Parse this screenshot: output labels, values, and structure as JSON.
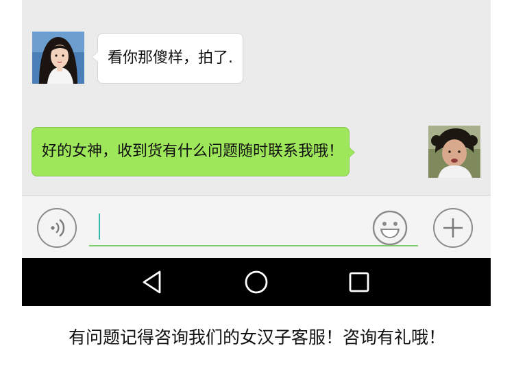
{
  "messages": [
    {
      "side": "left",
      "sender": "female-avatar",
      "text": "看你那傻样，拍了."
    },
    {
      "side": "right",
      "sender": "male-avatar",
      "text": "好的女神，收到货有什么问题随时联系我哦！"
    }
  ],
  "input": {
    "value": "",
    "placeholder": ""
  },
  "icons": {
    "voice": "voice-icon",
    "emoji": "emoji-icon",
    "add": "plus-icon",
    "back": "back-triangle-icon",
    "home": "home-circle-icon",
    "recents": "recents-square-icon"
  },
  "colors": {
    "chat_bg": "#ebebeb",
    "incoming_bubble": "#ffffff",
    "outgoing_bubble": "#9ee65a",
    "input_underline": "#7ecb6a",
    "caret": "#33b5a8",
    "navbar": "#000000"
  },
  "caption": "有问题记得咨询我们的女汉子客服！咨询有礼哦！"
}
